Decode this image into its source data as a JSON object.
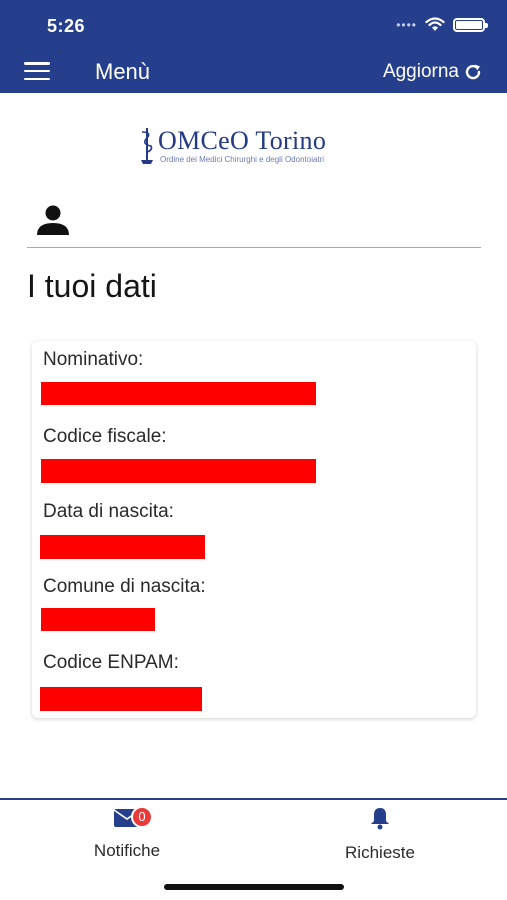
{
  "status_bar": {
    "time": "5:26"
  },
  "header": {
    "menu_title": "Menù",
    "refresh_label": "Aggiorna"
  },
  "logo": {
    "name": "OMCeO Torino",
    "subtitle": "Ordine dei Medici Chirurghi e degli Odontoiatri"
  },
  "section": {
    "title": "I tuoi dati"
  },
  "fields": [
    {
      "label": "Nominativo:"
    },
    {
      "label": "Codice fiscale:"
    },
    {
      "label": "Data di nascita:"
    },
    {
      "label": "Comune di nascita:"
    },
    {
      "label": "Codice ENPAM:"
    }
  ],
  "bottom_nav": {
    "notifications_label": "Notifiche",
    "notifications_badge": "0",
    "requests_label": "Richieste"
  },
  "colors": {
    "brand": "#263f8c",
    "redaction": "#ff0000",
    "badge": "#ea3a3a"
  }
}
